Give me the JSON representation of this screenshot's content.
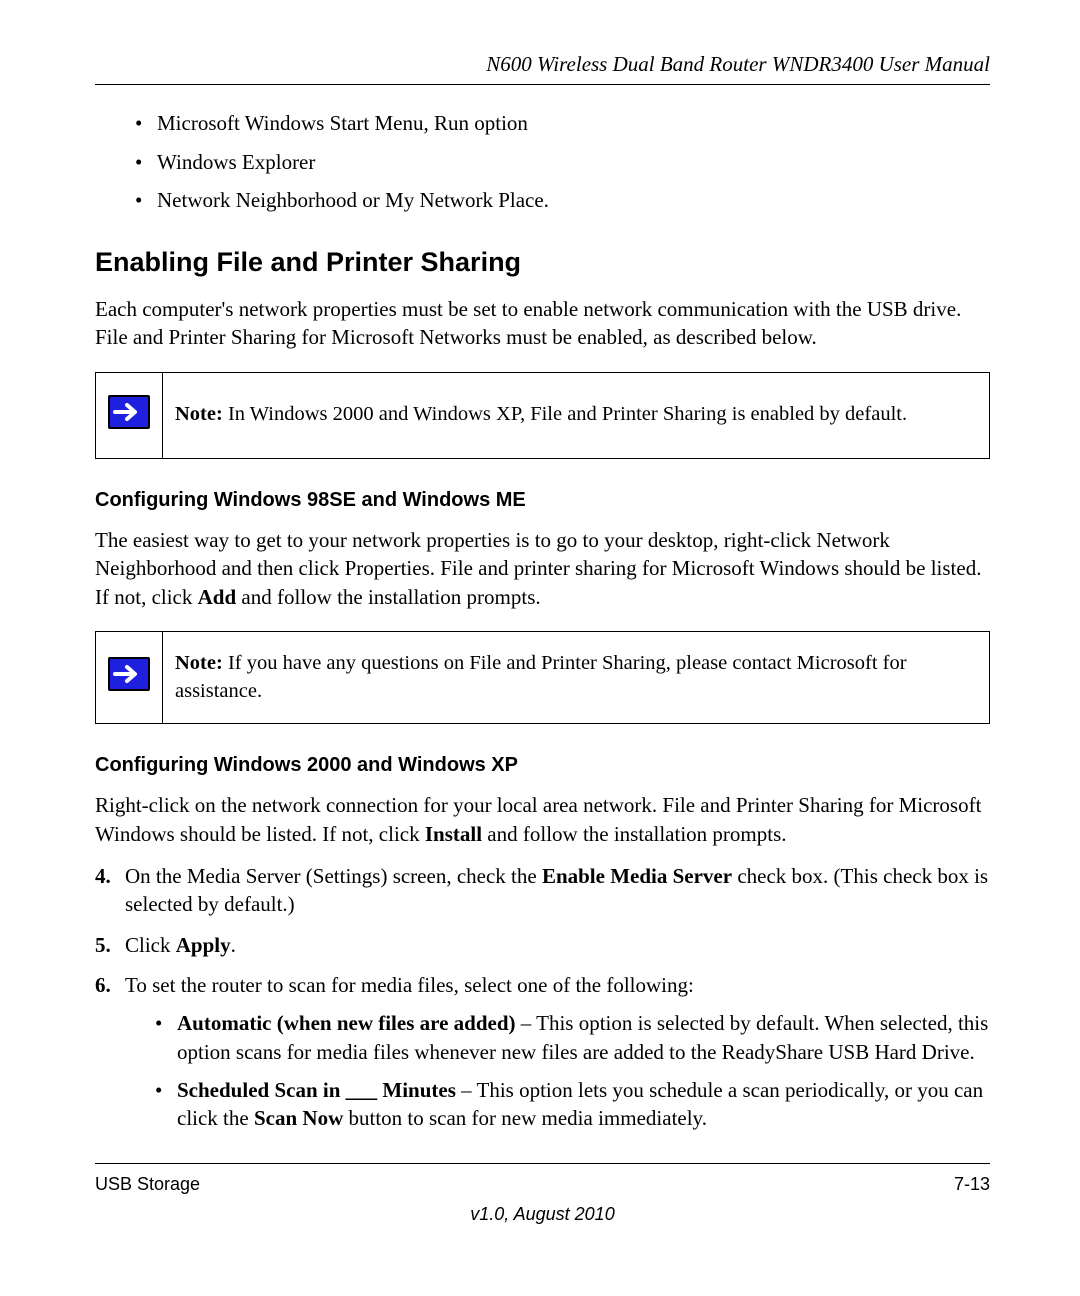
{
  "header": {
    "doc_title": "N600 Wireless Dual Band Router WNDR3400 User Manual"
  },
  "top_bullets": [
    "Microsoft Windows Start Menu, Run option",
    "Windows Explorer",
    "Network Neighborhood or My Network Place."
  ],
  "section_heading": "Enabling File and Printer Sharing",
  "section_intro": "Each computer's network properties must be set to enable network communication with the USB drive. File and Printer Sharing for Microsoft Networks must be enabled, as described below.",
  "note1": {
    "label": "Note:",
    "text": "In Windows 2000 and Windows XP, File and Printer Sharing is enabled by default."
  },
  "sub1_heading": "Configuring Windows 98SE and Windows ME",
  "sub1_body_pre": "The easiest way to get to your network properties is to go to your desktop, right-click Network Neighborhood and then click Properties. File and printer sharing for Microsoft Windows should be listed. If not, click ",
  "sub1_body_bold": "Add",
  "sub1_body_post": " and follow the installation prompts.",
  "note2": {
    "label": "Note:",
    "text": "If you have any questions on File and Printer Sharing, please contact Microsoft for assistance."
  },
  "sub2_heading": "Configuring Windows 2000 and Windows XP",
  "sub2_body_pre": "Right-click on the network connection for your local area network. File and Printer Sharing for Microsoft Windows should be listed. If not, click ",
  "sub2_body_bold": "Install",
  "sub2_body_post": " and follow the installation prompts.",
  "numlist": {
    "item4": {
      "num": "4.",
      "pre": "On the Media Server (Settings) screen, check the ",
      "bold": "Enable Media Server",
      "post": " check box. (This check box is selected by default.)"
    },
    "item5": {
      "num": "5.",
      "pre": "Click ",
      "bold": "Apply",
      "post": "."
    },
    "item6": {
      "num": "6.",
      "text": "To set the router to scan for media files, select one of the following:",
      "sub_a": {
        "bold": "Automatic (when new files are added)",
        "post": " – This option is selected by default. When selected, this option scans for media files whenever new files are added to the ReadyShare USB Hard Drive."
      },
      "sub_b": {
        "bold": "Scheduled Scan in ___ Minutes",
        "mid1": " – This option lets you schedule a scan periodically, or you can click the ",
        "bold2": "Scan Now",
        "post": " button to scan for new media immediately."
      }
    }
  },
  "footer": {
    "left": "USB Storage",
    "right": "7-13",
    "version": "v1.0, August 2010"
  }
}
